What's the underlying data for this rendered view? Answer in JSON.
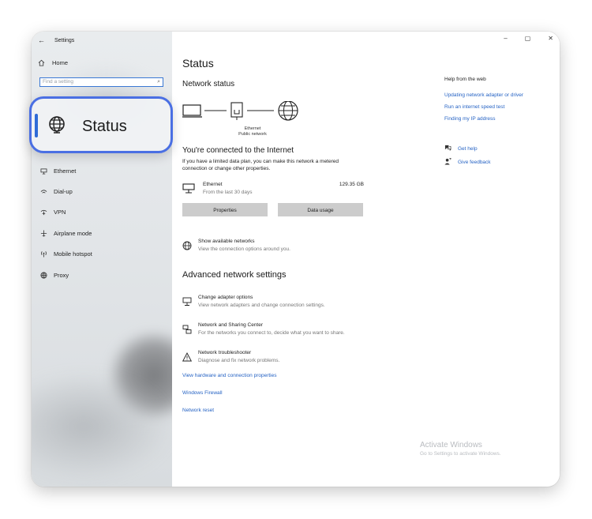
{
  "window": {
    "title": "Settings",
    "controls": [
      "–",
      "▢",
      "✕"
    ]
  },
  "sidebar": {
    "home": "Home",
    "search_placeholder": "Find a setting",
    "callout_label": "Status",
    "items": [
      {
        "label": "Ethernet",
        "icon": "ethernet-icon"
      },
      {
        "label": "Dial-up",
        "icon": "dialup-icon"
      },
      {
        "label": "VPN",
        "icon": "vpn-icon"
      },
      {
        "label": "Airplane mode",
        "icon": "airplane-icon"
      },
      {
        "label": "Mobile hotspot",
        "icon": "hotspot-icon"
      },
      {
        "label": "Proxy",
        "icon": "proxy-icon"
      }
    ]
  },
  "main": {
    "title": "Status",
    "network_status": "Network status",
    "diagram": {
      "adapter_label": "Ethernet",
      "network_label": "Public network"
    },
    "connected_title": "You're connected to the Internet",
    "connected_desc": "If you have a limited data plan, you can make this network a metered connection or change other properties.",
    "ethernet": {
      "name": "Ethernet",
      "sub": "From the last 30 days",
      "size": "129.35 GB"
    },
    "buttons": {
      "properties": "Properties",
      "data_usage": "Data usage"
    },
    "show_networks": {
      "title": "Show available networks",
      "sub": "View the connection options around you."
    },
    "advanced_title": "Advanced network settings",
    "advanced": [
      {
        "title": "Change adapter options",
        "sub": "View network adapters and change connection settings."
      },
      {
        "title": "Network and Sharing Center",
        "sub": "For the networks you connect to, decide what you want to share."
      },
      {
        "title": "Network troubleshooter",
        "sub": "Diagnose and fix network problems."
      }
    ],
    "links": [
      "View hardware and connection properties",
      "Windows Firewall",
      "Network reset"
    ]
  },
  "help": {
    "title": "Help from the web",
    "links": [
      "Updating network adapter or driver",
      "Run an internet speed test",
      "Finding my IP address"
    ],
    "get_help": "Get help",
    "give_feedback": "Give feedback"
  },
  "watermark": {
    "title": "Activate Windows",
    "sub": "Go to Settings to activate Windows."
  },
  "colors": {
    "accent": "#2f6bd6",
    "link": "#2663c4",
    "callout_border": "#4a6fe3"
  }
}
